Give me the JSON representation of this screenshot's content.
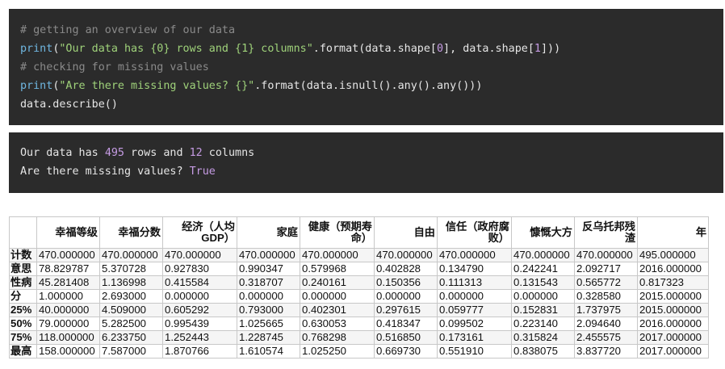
{
  "code_cell": {
    "line1": "# getting an overview of our data",
    "line2": {
      "fn": "print",
      "open": "(",
      "str": "\"Our data has {0} rows and {1} columns\"",
      "mid": ".format(data.shape[",
      "n0": "0",
      "mid2": "], data.shape[",
      "n1": "1",
      "end": "]))"
    },
    "line3": "# checking for missing values",
    "line4": {
      "fn": "print",
      "open": "(",
      "str": "\"Are there missing values? {}\"",
      "end": ".format(data.isnull().any().any()))"
    },
    "line5": "data.describe()"
  },
  "output_cell": {
    "line1": {
      "pre": "Our data has ",
      "rows": "495",
      "mid": " rows and ",
      "cols": "12",
      "post": " columns"
    },
    "line2": {
      "pre": "Are there missing values? ",
      "value": "True"
    }
  },
  "table": {
    "columns": [
      "幸福等级",
      "幸福分数",
      "经济（人均GDP）",
      "家庭",
      "健康（预期寿命）",
      "自由",
      "信任（政府腐败）",
      "慷慨大方",
      "反乌托邦残渣",
      "年"
    ],
    "rows": [
      {
        "label": "计数",
        "cells": [
          "470.000000",
          "470.000000",
          "470.000000",
          "470.000000",
          "470.000000",
          "470.000000",
          "470.000000",
          "470.000000",
          "470.000000",
          "495.000000"
        ]
      },
      {
        "label": "意思",
        "cells": [
          "78.829787",
          "5.370728",
          "0.927830",
          "0.990347",
          "0.579968",
          "0.402828",
          "0.134790",
          "0.242241",
          "2.092717",
          "2016.000000"
        ]
      },
      {
        "label": "性病",
        "cells": [
          "45.281408",
          "1.136998",
          "0.415584",
          "0.318707",
          "0.240161",
          "0.150356",
          "0.111313",
          "0.131543",
          "0.565772",
          "0.817323"
        ]
      },
      {
        "label": "分",
        "cells": [
          "1.000000",
          "2.693000",
          "0.000000",
          "0.000000",
          "0.000000",
          "0.000000",
          "0.000000",
          "0.000000",
          "0.328580",
          "2015.000000"
        ]
      },
      {
        "label": "25%",
        "cells": [
          "40.000000",
          "4.509000",
          "0.605292",
          "0.793000",
          "0.402301",
          "0.297615",
          "0.059777",
          "0.152831",
          "1.737975",
          "2015.000000"
        ]
      },
      {
        "label": "50%",
        "cells": [
          "79.000000",
          "5.282500",
          "0.995439",
          "1.025665",
          "0.630053",
          "0.418347",
          "0.099502",
          "0.223140",
          "2.094640",
          "2016.000000"
        ]
      },
      {
        "label": "75%",
        "cells": [
          "118.000000",
          "6.233750",
          "1.252443",
          "1.228745",
          "0.768298",
          "0.516850",
          "0.173161",
          "0.315824",
          "2.455575",
          "2017.000000"
        ]
      },
      {
        "label": "最高",
        "cells": [
          "158.000000",
          "7.587000",
          "1.870766",
          "1.610574",
          "1.025250",
          "0.669730",
          "0.551910",
          "0.838075",
          "3.837720",
          "2017.000000"
        ]
      }
    ]
  },
  "colors": {
    "cell_background": "#2b2b2b",
    "comment": "#8a8a8a",
    "keyword": "#6fb6e0",
    "string": "#9fd27a",
    "number": "#c59be3"
  }
}
